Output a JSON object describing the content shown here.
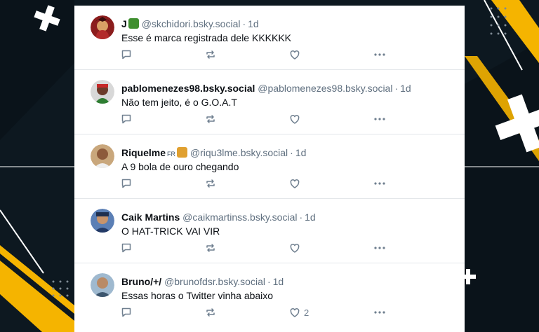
{
  "posts": [
    {
      "name": "J",
      "handle": "@skchidori.bsky.social",
      "time": "1d",
      "text": "Esse é marca registrada dele KKKKKK",
      "like_count": ""
    },
    {
      "name": "pablomenezes98.bsky.social",
      "handle": "@pablomenezes98.bsky.social",
      "time": "1d",
      "text": "Não tem jeito, é o G.O.A.T",
      "like_count": ""
    },
    {
      "name": "Riquelme",
      "badge": "FR",
      "handle": "@riqu3lme.bsky.social",
      "time": "1d",
      "text": "A 9 bola de ouro chegando",
      "like_count": ""
    },
    {
      "name": "Caik Martins",
      "handle": "@caikmartinss.bsky.social",
      "time": "1d",
      "text": "O HAT-TRICK VAI VIR",
      "like_count": ""
    },
    {
      "name": "Bruno/+/",
      "handle": "@brunofdsr.bsky.social",
      "time": "1d",
      "text": "Essas horas o Twitter vinha abaixo",
      "like_count": "2"
    }
  ],
  "colors": {
    "background": "#0d1820",
    "accent": "#f5b400",
    "card": "#ffffff",
    "icon": "#6f7f8f"
  },
  "icons": {
    "reply": "reply-icon",
    "repost": "repost-icon",
    "like": "heart-icon",
    "more": "more-icon"
  }
}
